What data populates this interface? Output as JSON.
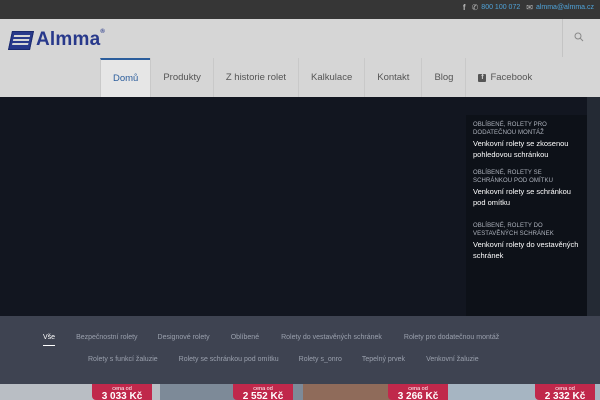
{
  "topbar": {
    "phone": "800 100 072",
    "email": "almma@almma.cz"
  },
  "brand": {
    "name": "Almma",
    "reg": "®",
    "color": "#28398b"
  },
  "nav": {
    "items": [
      {
        "label": "Domů",
        "active": true
      },
      {
        "label": "Produkty"
      },
      {
        "label": "Z historie rolet"
      },
      {
        "label": "Kalkulace"
      },
      {
        "label": "Kontakt"
      },
      {
        "label": "Blog"
      },
      {
        "label": "Facebook",
        "icon": "facebook-icon"
      }
    ],
    "accent": "#2b5d9c"
  },
  "slider": {
    "items": [
      {
        "category": "OBLÍBENÉ, ROLETY PRO DODATEČNOU MONTÁŽ",
        "title": "Venkovní rolety se zkosenou pohledovou schránkou"
      },
      {
        "category": "OBLÍBENÉ, ROLETY SE SCHRÁNKOU POD OMÍTKU",
        "title": "Venkovní rolety se schránkou pod omítku"
      },
      {
        "category": "OBLÍBENÉ, ROLETY DO VESTAVĚNÝCH SCHRÁNEK",
        "title": "Venkovní rolety do vestavěných schránek"
      }
    ]
  },
  "filters": {
    "row1": [
      "Vše",
      "Bezpečnostní rolety",
      "Designové rolety",
      "Oblíbené",
      "Rolety do vestavěných schránek",
      "Rolety pro dodatečnou montáž"
    ],
    "row2": [
      "Rolety s funkcí žaluzie",
      "Rolety se schránkou pod omítku",
      "Rolety s_onro",
      "Tepelný prvek",
      "Venkovní žaluzie"
    ],
    "active": "Vše"
  },
  "products": {
    "badge_label": "cena od",
    "prices": [
      "3 033 Kč",
      "2 552 Kč",
      "3 266 Kč",
      "2 332 Kč"
    ],
    "badge_color": "#c0284b"
  }
}
